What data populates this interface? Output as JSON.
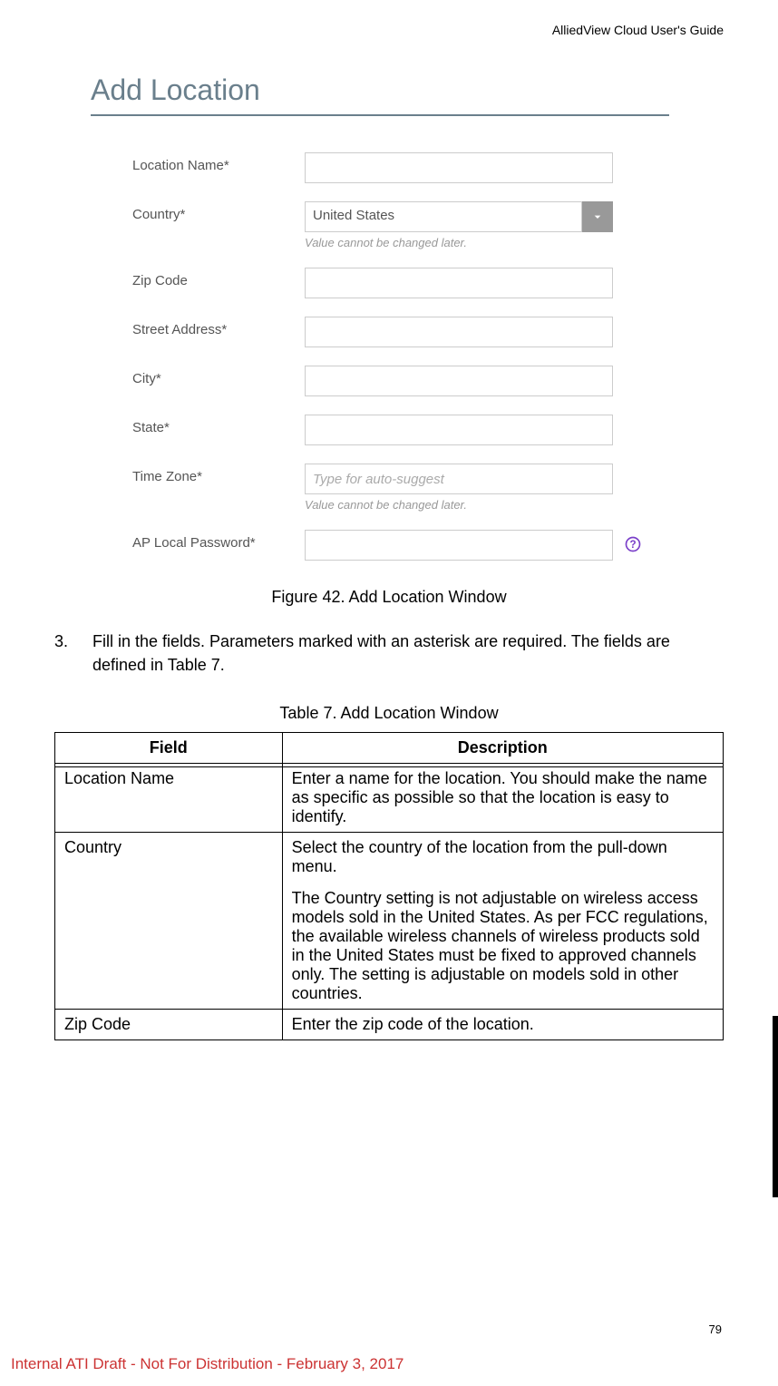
{
  "header": {
    "doc_title": "AlliedView Cloud User's Guide"
  },
  "form": {
    "title": "Add Location",
    "fields": {
      "location_name": {
        "label": "Location Name*"
      },
      "country": {
        "label": "Country*",
        "value": "United States",
        "hint": "Value cannot be changed later."
      },
      "zip_code": {
        "label": "Zip Code"
      },
      "street_address": {
        "label": "Street Address*"
      },
      "city": {
        "label": "City*"
      },
      "state": {
        "label": "State*"
      },
      "time_zone": {
        "label": "Time Zone*",
        "placeholder": "Type for auto-suggest",
        "hint": "Value cannot be changed later."
      },
      "ap_local_password": {
        "label": "AP Local Password*"
      }
    }
  },
  "figure_caption": "Figure 42. Add Location Window",
  "step": {
    "num": "3.",
    "text": "Fill in the fields. Parameters marked with an asterisk are required. The fields are defined in Table 7."
  },
  "table": {
    "caption": "Table 7. Add Location Window",
    "headers": {
      "field": "Field",
      "description": "Description"
    },
    "rows": [
      {
        "field": "Location Name",
        "desc": [
          "Enter a name for the location. You should make the name as specific as possible so that the location is easy to identify."
        ]
      },
      {
        "field": "Country",
        "desc": [
          "Select the country of the location from the pull-down menu.",
          "The Country setting is not adjustable on wireless access models sold in the United States. As per FCC regulations, the available wireless channels of wireless products sold in the United States must be fixed to approved channels only. The setting is adjustable on models sold in other countries."
        ]
      },
      {
        "field": "Zip Code",
        "desc": [
          "Enter the zip code of the location."
        ]
      }
    ]
  },
  "page_num": "79",
  "footer": "Internal ATI Draft - Not For Distribution - February 3, 2017"
}
